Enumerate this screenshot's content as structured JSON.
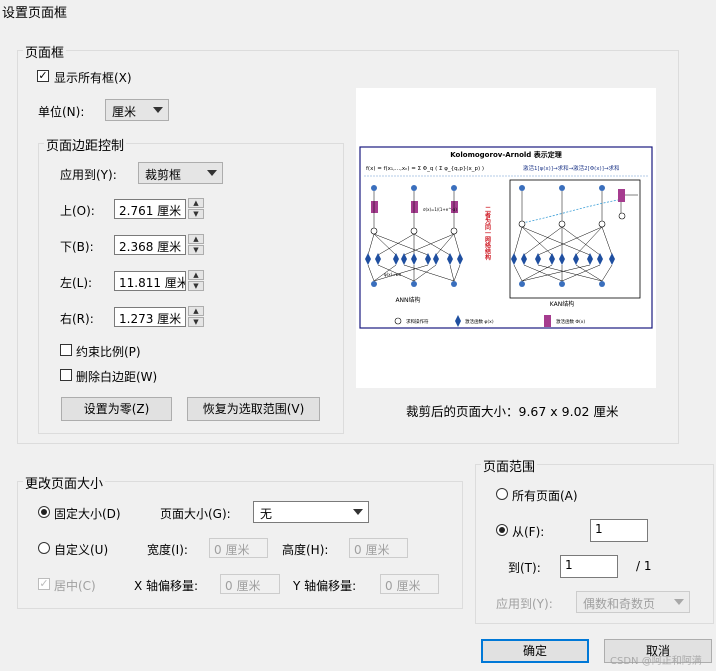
{
  "window": {
    "title": "设置页面框"
  },
  "page_box": {
    "legend": "页面框",
    "show_all_boxes": {
      "label": "显示所有框(X)",
      "checked": true
    },
    "unit": {
      "label": "单位(N):",
      "value": "厘米"
    },
    "margins": {
      "legend": "页面边距控制",
      "apply_to": {
        "label": "应用到(Y):",
        "value": "裁剪框"
      },
      "top": {
        "label": "上(O):",
        "value": "2.761 厘米"
      },
      "bottom": {
        "label": "下(B):",
        "value": "2.368 厘米"
      },
      "left": {
        "label": "左(L):",
        "value": "11.811 厘米"
      },
      "right": {
        "label": "右(R):",
        "value": "1.273 厘米"
      },
      "constrain": {
        "label": "约束比例(P)",
        "checked": false
      },
      "remove_white": {
        "label": "删除白边距(W)",
        "checked": false
      },
      "set_zero": "设置为零(Z)",
      "revert": "恢复为选取范围(V)"
    },
    "cropped_size": "裁剪后的页面大小：9.67 x 9.02 厘米"
  },
  "preview": {
    "title": "Kolomogorov-Arnold 表示定理",
    "formula_a": "f(x) = f(x₁,...,xₙ) = Σ Φ_q ( Σ φ_{q,p}(x_p) )",
    "formula_b": "激活1[φ(x)]→求和→激活2[Φ(x)]→求和",
    "middle_text": "二者为同一网络结构",
    "sigmoid": "σ(x)=1/(1+e^-x)",
    "phi_left": "φ(x)=wx",
    "ann_label": "ANN结构",
    "kan_label": "KAN结构",
    "legend_sum": "求和操作符",
    "legend_act1": "激活函数 φ(x)",
    "legend_act2": "激活函数 Φ(x)"
  },
  "change_size": {
    "legend": "更改页面大小",
    "fixed": {
      "label": "固定大小(D)",
      "selected": true
    },
    "page_size": {
      "label": "页面大小(G):",
      "value": "无"
    },
    "custom": {
      "label": "自定义(U)",
      "selected": false
    },
    "width": {
      "label": "宽度(I):",
      "value": "0 厘米"
    },
    "height": {
      "label": "高度(H):",
      "value": "0 厘米"
    },
    "center": {
      "label": "居中(C)",
      "checked": true
    },
    "x_offset": {
      "label": "X 轴偏移量:",
      "value": "0 厘米"
    },
    "y_offset": {
      "label": "Y 轴偏移量:",
      "value": "0 厘米"
    }
  },
  "page_range": {
    "legend": "页面范围",
    "all": {
      "label": "所有页面(A)",
      "selected": false
    },
    "from": {
      "label": "从(F):",
      "value": "1",
      "selected": true
    },
    "to": {
      "label": "到(T):",
      "value": "1",
      "total": "/ 1"
    },
    "apply_to": {
      "label": "应用到(Y):",
      "value": "偶数和奇数页"
    }
  },
  "buttons": {
    "ok": "确定",
    "cancel": "取消"
  },
  "watermark": "CSDN @阿正和阿满"
}
